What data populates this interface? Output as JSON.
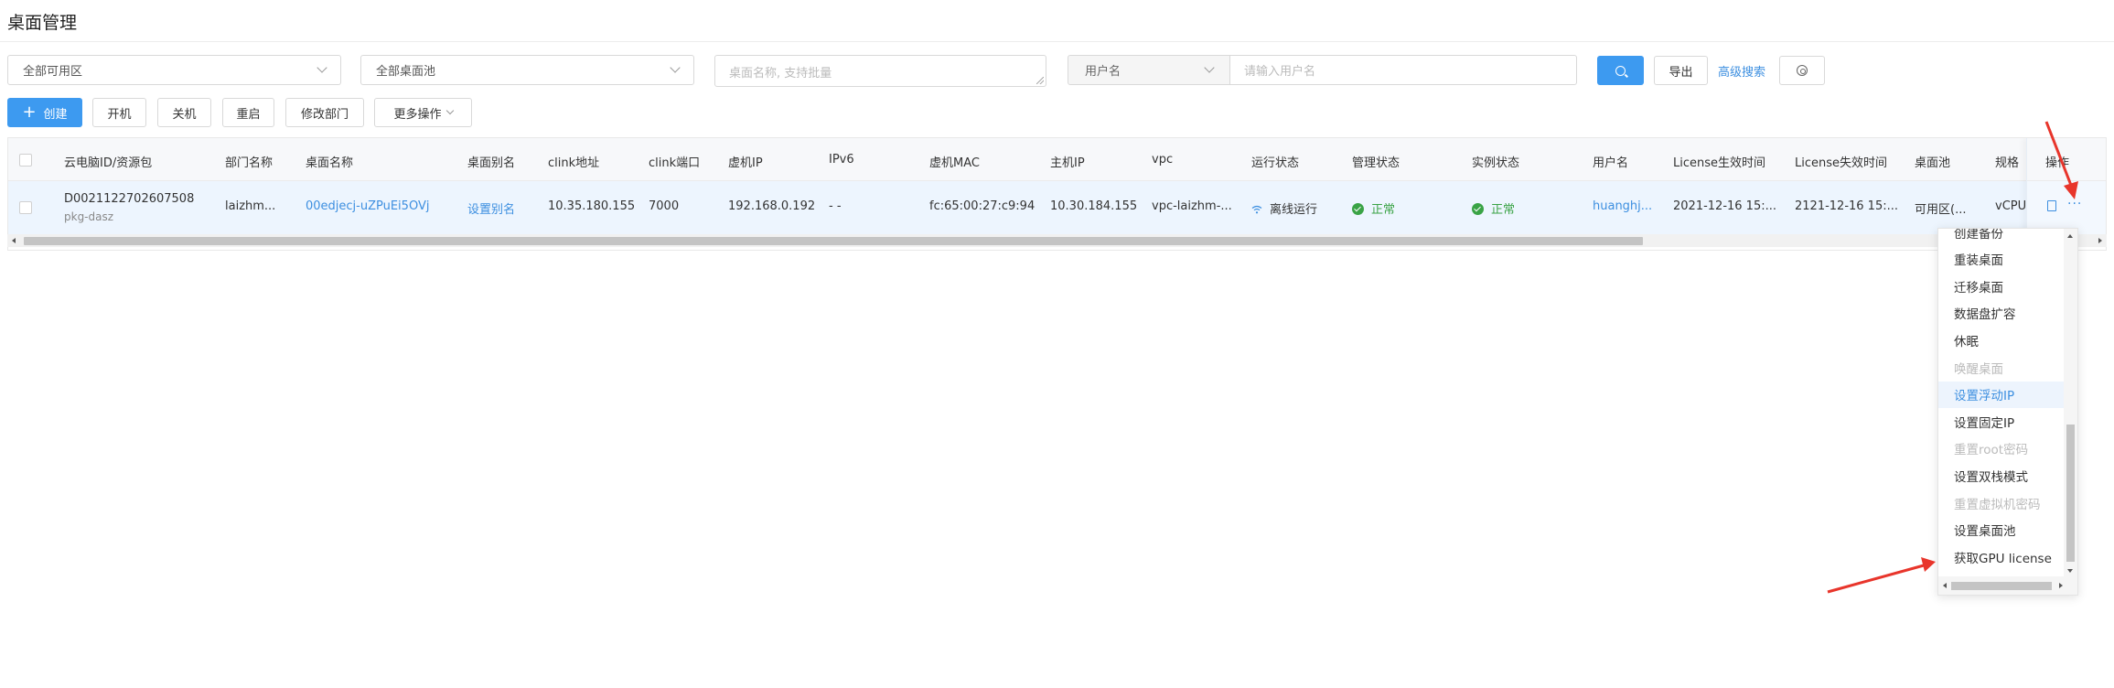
{
  "page": {
    "title": "桌面管理"
  },
  "filters": {
    "zone": "全部可用区",
    "pool": "全部桌面池",
    "name_placeholder": "桌面名称, 支持批量",
    "user_type": "用户名",
    "user_placeholder": "请输入用户名",
    "export_label": "导出",
    "advanced_label": "高级搜索"
  },
  "actions": {
    "create": "创建",
    "power_on": "开机",
    "power_off": "关机",
    "restart": "重启",
    "change_dept": "修改部门",
    "more": "更多操作"
  },
  "table": {
    "headers": [
      "云电脑ID/资源包",
      "部门名称",
      "桌面名称",
      "桌面别名",
      "clink地址",
      "clink端口",
      "虚机IP",
      "IPv6",
      "虚机MAC",
      "主机IP",
      "vpc",
      "运行状态",
      "管理状态",
      "实例状态",
      "用户名",
      "License生效时间",
      "License失效时间",
      "桌面池",
      "规格",
      "操作"
    ],
    "rows": [
      {
        "id": "D0021122702607508",
        "package": "pkg-dasz",
        "dept": "laizhm...",
        "desktop_name": "00edjecj-uZPuEi5OVj",
        "alias": "设置别名",
        "clink_addr": "10.35.180.155",
        "clink_port": "7000",
        "vm_ip": "192.168.0.192",
        "ipv6": "- -",
        "vm_mac": "fc:65:00:27:c9:94",
        "host_ip": "10.30.184.155",
        "vpc": "vpc-laizhm-...",
        "run_status": "离线运行",
        "manage_status": "正常",
        "instance_status": "正常",
        "username": "huanghj...",
        "license_start": "2021-12-16 15:...",
        "license_end": "2121-12-16 15:...",
        "pool": "可用区(...",
        "spec": "vCPU",
        "op_more": "···"
      }
    ]
  },
  "menu": {
    "items": [
      {
        "label": "创建备份",
        "state": "normal"
      },
      {
        "label": "重装桌面",
        "state": "normal"
      },
      {
        "label": "迁移桌面",
        "state": "normal"
      },
      {
        "label": "数据盘扩容",
        "state": "normal"
      },
      {
        "label": "休眠",
        "state": "normal"
      },
      {
        "label": "唤醒桌面",
        "state": "disabled"
      },
      {
        "label": "设置浮动IP",
        "state": "active"
      },
      {
        "label": "设置固定IP",
        "state": "normal"
      },
      {
        "label": "重置root密码",
        "state": "disabled"
      },
      {
        "label": "设置双栈模式",
        "state": "normal"
      },
      {
        "label": "重置虚拟机密码",
        "state": "disabled"
      },
      {
        "label": "设置桌面池",
        "state": "normal"
      },
      {
        "label": "获取GPU license",
        "state": "normal"
      }
    ]
  },
  "colors": {
    "primary": "#3d9af0",
    "link": "#3d8fe0",
    "success": "#3aa346",
    "annotation_arrow": "#e8352b"
  }
}
